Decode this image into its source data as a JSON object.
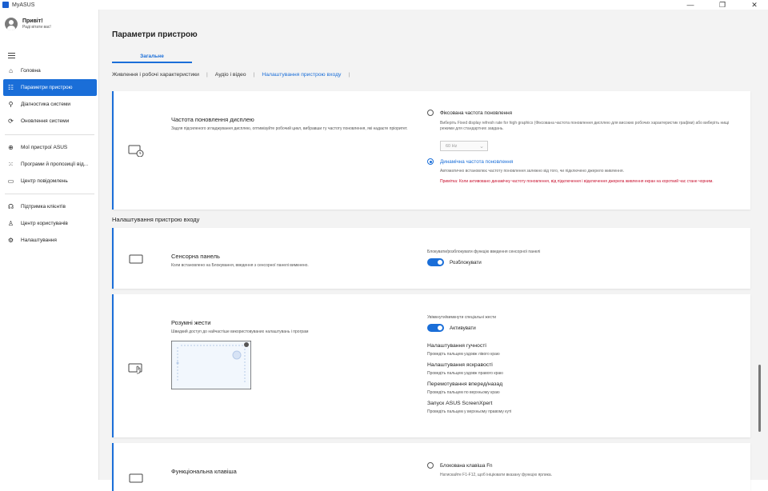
{
  "window": {
    "title": "MyASUS",
    "minimize": "—",
    "maximize": "❐",
    "close": "✕"
  },
  "user": {
    "greeting": "Привіт!",
    "subtitle": "Раді вітати вас!"
  },
  "sidebar": {
    "items": [
      {
        "label": "Головна",
        "icon": "home-icon"
      },
      {
        "label": "Параметри пристрою",
        "icon": "sliders-icon"
      },
      {
        "label": "Діагностика системи",
        "icon": "diagnostics-icon"
      },
      {
        "label": "Оновлення системи",
        "icon": "update-icon"
      },
      {
        "label": "Мої пристрої ASUS",
        "icon": "devices-icon"
      },
      {
        "label": "Програми й пропозиції від...",
        "icon": "apps-icon"
      },
      {
        "label": "Центр повідомлень",
        "icon": "message-icon"
      },
      {
        "label": "Підтримка клієнтів",
        "icon": "headset-icon"
      },
      {
        "label": "Центр користувачів",
        "icon": "user-icon"
      },
      {
        "label": "Налаштування",
        "icon": "gear-icon"
      }
    ]
  },
  "main": {
    "title": "Параметри пристрою",
    "tab": "Загальне",
    "subtabs": [
      "Живлення і робочі характеристики",
      "Аудіо і відео",
      "Налаштування пристрою входу"
    ],
    "section_title": "Налаштування пристрою входу",
    "refresh": {
      "title": "Частота поновлення дисплею",
      "desc": "Задля підсиленого згладжування дисплею, оптимізуйте робочий цикл, вибравши ту частоту поновлення, які надаєте пріоритет.",
      "opt1_label": "Фіксована частота поновлення",
      "opt1_desc": "Виберіть Fixed display refresh rate for high graphics (Фіксована частота поновлення дисплею для високих робочих характеристик графіки) або виберіть нищі режими для стандартних завдань.",
      "select_value": "60 Hz",
      "opt2_label": "Динамічна частота поновлення",
      "opt2_desc": "Автоматично встановлює частоту поновлення залежно від того, чи підключено джерело живлення.",
      "warning": "Примітка: Коли активовано динамічну частоту поновлення, від підключення і відключення джерела живлення екран на короткий час стане чорним."
    },
    "touchpad": {
      "title": "Сенсорна панель",
      "desc": "Коли встановлено на Блокування, введення з сенсорної панелі вимкнено.",
      "toggle_caption": "Блокувати/розблокувати функцію введення сенсорної панелі",
      "toggle_label": "Розблокувати"
    },
    "gestures": {
      "title": "Розумні жести",
      "desc": "Швидкий доступ до найчастіше використовуваних налаштувань і програм",
      "toggle_caption": "Увімкнути/вимкнути спеціальні жести",
      "toggle_label": "Активувати",
      "items": [
        {
          "title": "Налаштування гучності",
          "desc": "Проведіть пальцем уздовж лівого краю"
        },
        {
          "title": "Налаштування яскравості",
          "desc": "Проведіть пальцем уздовж правого краю"
        },
        {
          "title": "Перемотування вперед/назад",
          "desc": "Проведіть пальцем по верхньому краю"
        },
        {
          "title": "Запуск ASUS ScreenXpert",
          "desc": "Проведіть пальцем у верхньому правому куті"
        }
      ]
    },
    "fnkey": {
      "title": "Функціональна клавіша",
      "opt1_label": "Блокована клавіша Fn",
      "opt1_desc": "Натискайте F1-F12, щоб ініціювати вказану функцію ярлика."
    }
  },
  "colors": {
    "accent": "#1a6ed8",
    "warning": "#c8102e"
  }
}
